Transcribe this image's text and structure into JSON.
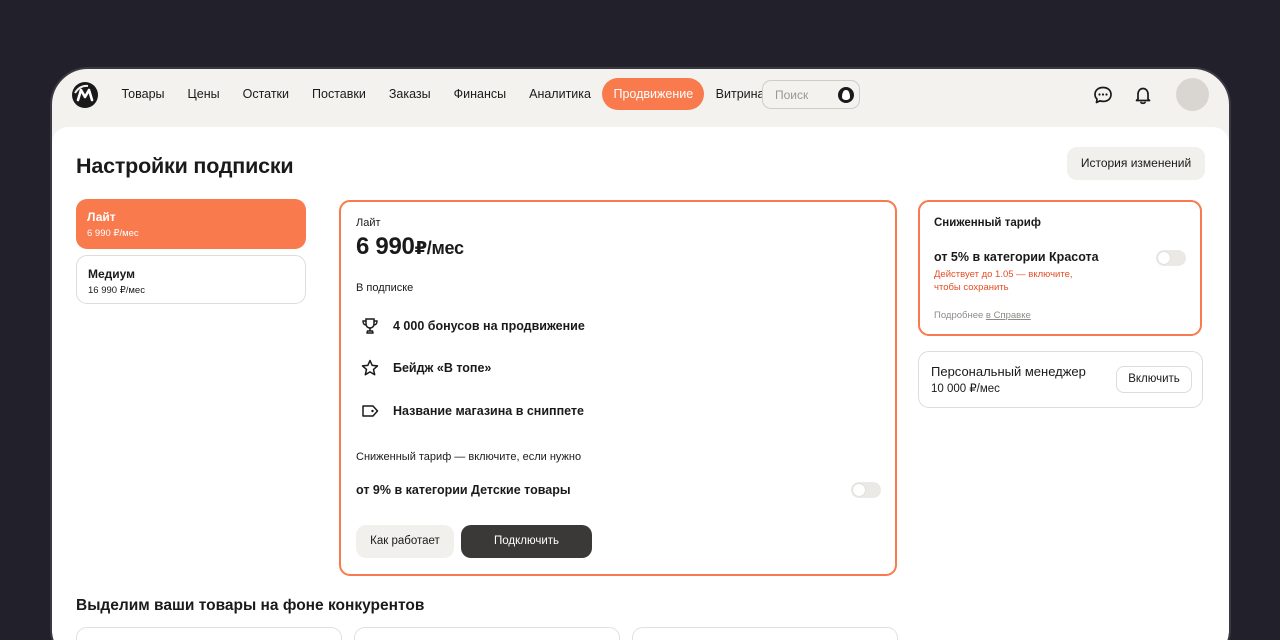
{
  "nav": {
    "logo": "market-logo",
    "items": [
      "Товары",
      "Цены",
      "Остатки",
      "Поставки",
      "Заказы",
      "Финансы",
      "Аналитика",
      "Продвижение",
      "Витрина"
    ],
    "active": "Продвижение",
    "search_placeholder": "Поиск"
  },
  "page": {
    "title": "Настройки подписки",
    "history_button": "История изменений"
  },
  "tariffs": [
    {
      "name": "Лайт",
      "price": "6 990 ₽/мес"
    },
    {
      "name": "Медиум",
      "price": "16 990 ₽/мес"
    }
  ],
  "main_card": {
    "plan_name": "Лайт",
    "price": "6 990",
    "price_unit": "₽/мес",
    "included_label": "В подписке",
    "features": [
      {
        "icon": "trophy-icon",
        "text": "4 000 бонусов на продвижение"
      },
      {
        "icon": "star-icon",
        "text": "Бейдж «В топе»"
      },
      {
        "icon": "tag-icon",
        "text": "Название магазина в сниппете"
      }
    ],
    "reduced_label": "Сниженный тариф — включите, если нужно",
    "reduced_category": "от 9% в категории Детские товары",
    "how_button": "Как работает",
    "connect_button": "Подключить"
  },
  "side_card": {
    "title": "Сниженный тариф",
    "category": "от 5% в категории Красота",
    "note": "Действует до 1.05 — включите, чтобы сохранить",
    "more_prefix": "Подробнее ",
    "more_link": "в Справке"
  },
  "manager_card": {
    "title": "Персональный менеджер",
    "price": "10 000 ₽/мес",
    "button": "Включить"
  },
  "section": {
    "title": "Выделим ваши товары на фоне конкурентов"
  },
  "colors": {
    "accent": "#f97a4d",
    "dark_button": "#3a3937",
    "warning_text": "#e54e25",
    "background": "#22212b"
  }
}
